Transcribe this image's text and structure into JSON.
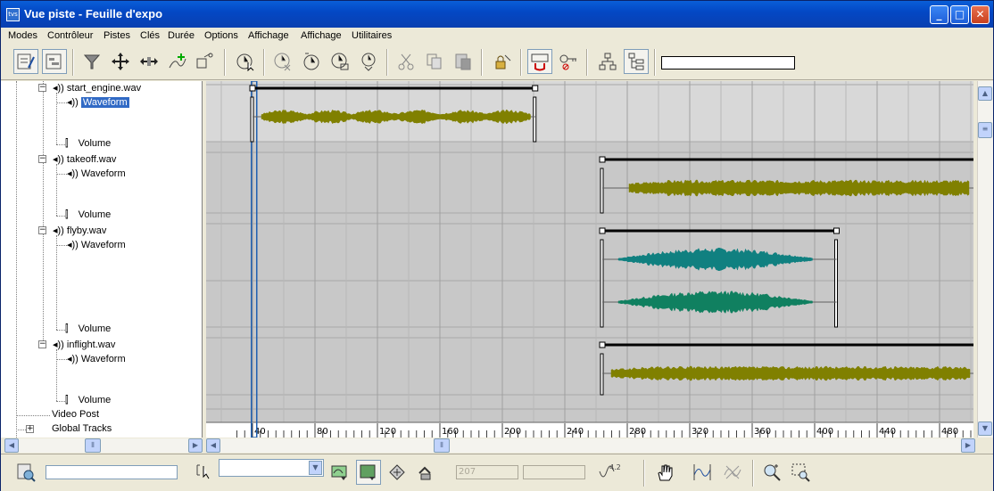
{
  "window": {
    "title": "Vue piste - Feuille d'expo",
    "icon_label": "tvs",
    "min_glyph": "_",
    "max_glyph": "□",
    "close_glyph": "✕"
  },
  "menu": [
    "Modes",
    "Contrôleur",
    "Pistes",
    "Clés",
    "Durée",
    "Options",
    "Affichage",
    "Affichage",
    "Utilitaires"
  ],
  "tree": {
    "tracks": [
      {
        "name": "start_engine.wav",
        "waveform": "Waveform",
        "volume": "Volume",
        "waveform_selected": true
      },
      {
        "name": "takeoff.wav",
        "waveform": "Waveform",
        "volume": "Volume",
        "waveform_selected": false
      },
      {
        "name": "flyby.wav",
        "waveform": "Waveform",
        "volume": "Volume",
        "waveform_selected": false
      },
      {
        "name": "inflight.wav",
        "waveform": "Waveform",
        "volume": "Volume",
        "waveform_selected": false
      }
    ],
    "video_post": "Video Post",
    "global_tracks": "Global Tracks",
    "expand_glyph": "−",
    "collapsed_glyph": "+"
  },
  "ruler": {
    "ticks": [
      "40",
      "80",
      "120",
      "160",
      "200",
      "240",
      "280",
      "320",
      "360",
      "400",
      "440",
      "480"
    ],
    "start": 30,
    "end": 520
  },
  "clips": [
    {
      "track": "start_engine.wav",
      "start": 40,
      "end": 221,
      "color": "#808000",
      "channels": 1
    },
    {
      "track": "takeoff.wav",
      "start": 264,
      "end": 520,
      "color": "#808000",
      "channels": 1
    },
    {
      "track": "flyby.wav",
      "start": 264,
      "end": 414,
      "color": "#108080",
      "channels": 2,
      "second_color": "#108060"
    },
    {
      "track": "inflight.wav",
      "start": 264,
      "end": 520,
      "color": "#808000",
      "channels": 1
    }
  ],
  "time_slider": 41,
  "status": {
    "frame_field": "207",
    "key_value": "4.2"
  },
  "colors": {
    "titlebar": "#0348c5",
    "selection": "#316ac5",
    "waveform_olive": "#808000",
    "waveform_teal": "#108080",
    "waveform_green": "#108060"
  }
}
